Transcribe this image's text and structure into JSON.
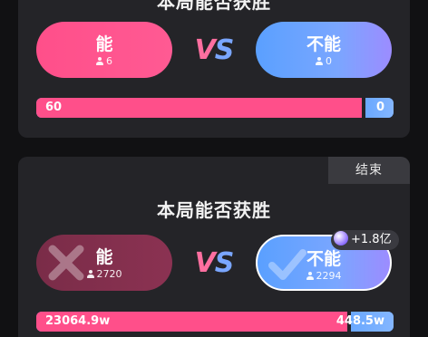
{
  "battles": [
    {
      "title": "本局能否获胜",
      "status_badge": "",
      "yes": {
        "label": "能",
        "count": "6"
      },
      "vs_v": "V",
      "vs_s": "S",
      "no": {
        "label": "不能",
        "count": "0"
      },
      "progress": {
        "yes_value": "60",
        "no_value": "0",
        "yes_fraction": 0.91
      }
    },
    {
      "title": "本局能否获胜",
      "status_badge": "结束",
      "yes": {
        "label": "能",
        "count": "2720"
      },
      "vs_v": "V",
      "vs_s": "S",
      "no": {
        "label": "不能",
        "count": "2294",
        "gift_badge": "+1.8亿"
      },
      "progress": {
        "yes_value": "23064.9w",
        "no_value": "448.5w",
        "yes_fraction": 0.87
      }
    }
  ],
  "colors": {
    "yes": "#ff4f8a",
    "no": "#5aa0ff",
    "card": "#242428",
    "background": "#111113"
  },
  "icons": {
    "person": "person-icon",
    "gift": "gift-icon",
    "cross_mark": "cross-mark-icon",
    "check_mark": "check-mark-icon"
  }
}
